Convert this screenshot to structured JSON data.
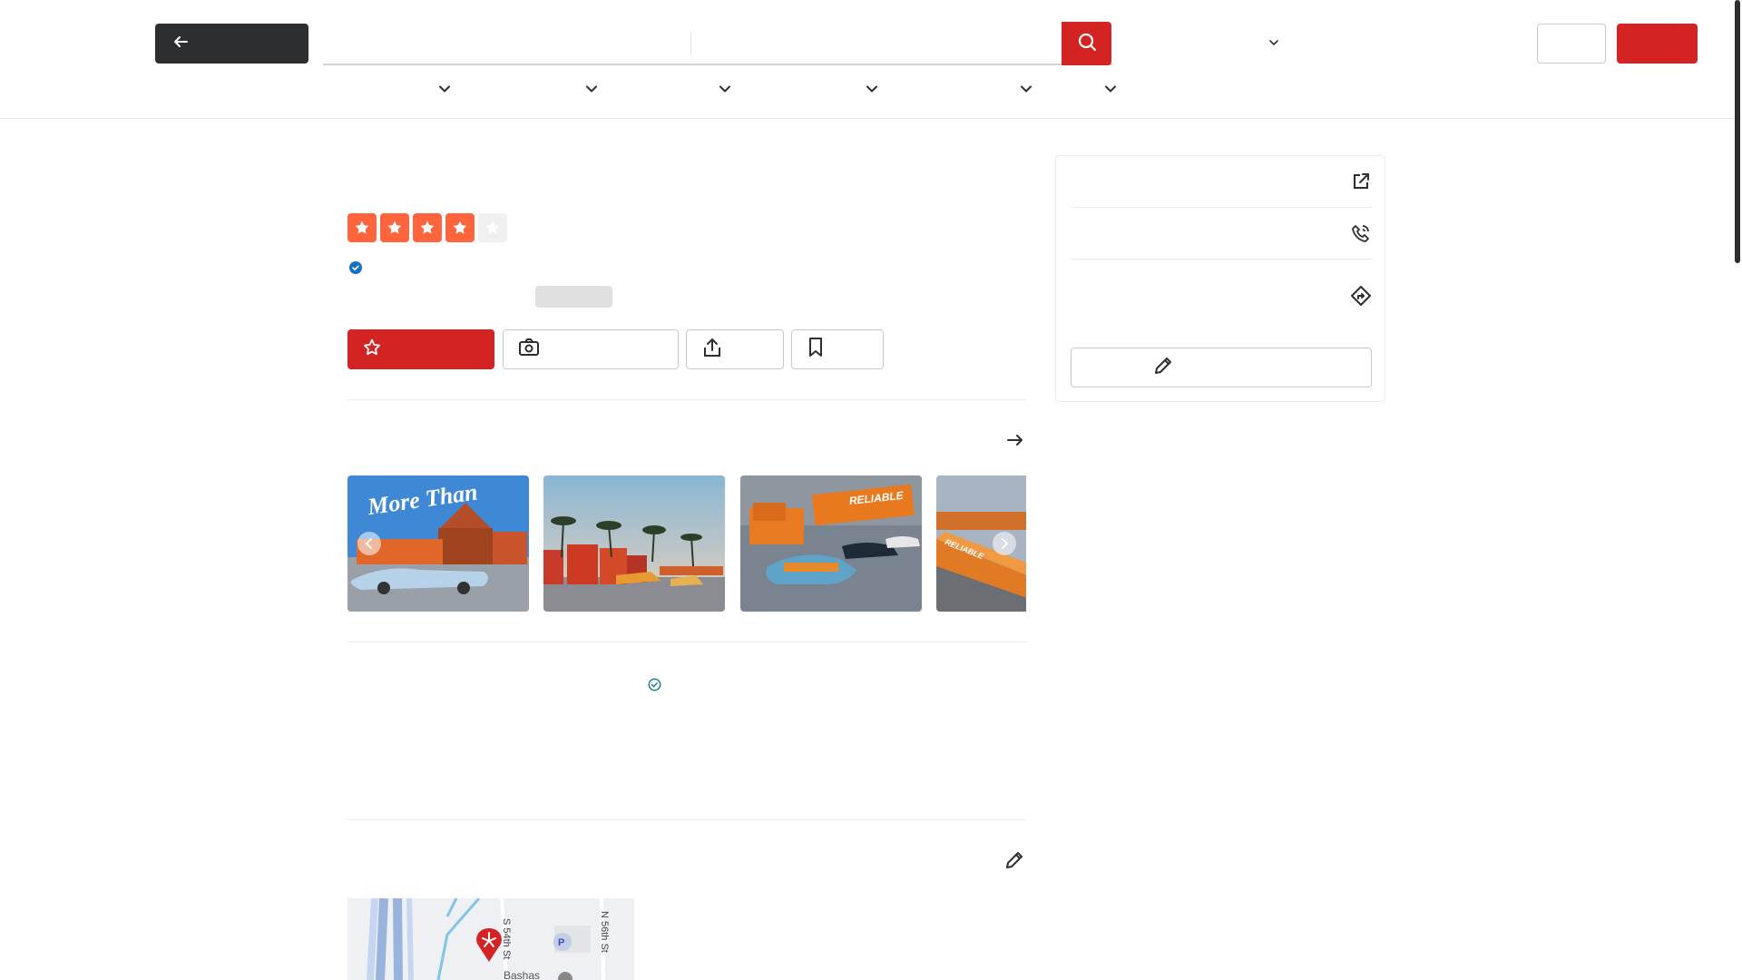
{
  "header": {
    "back_icon": "arrow-left-icon",
    "search_icon": "search-icon",
    "search_button_color": "#d32323",
    "signup_button_color": "#d32323",
    "category_chevron_count": 6
  },
  "business": {
    "rating": {
      "value": 4,
      "max": 5,
      "star_color": "#ff643d"
    },
    "verified_icon": "verified-badge-icon"
  },
  "actions": {
    "review_icon": "star-outline-icon",
    "photo_icon": "camera-icon",
    "share_icon": "share-icon",
    "save_icon": "bookmark-icon"
  },
  "photos": {
    "items": [
      {
        "caption": "More Than",
        "icon": "photo-thumbnail"
      },
      {
        "caption": "",
        "icon": "photo-thumbnail"
      },
      {
        "caption": "RELIABLE",
        "icon": "photo-thumbnail"
      },
      {
        "caption": "RELIABLE",
        "icon": "photo-thumbnail"
      }
    ],
    "see_all_icon": "arrow-right-icon"
  },
  "map": {
    "street_1": "S 54th St",
    "street_2": "N 56th St",
    "place": "Bashas",
    "parking": "P"
  },
  "sidebar": {
    "website_icon": "external-link-icon",
    "phone_icon": "phone-icon",
    "directions_icon": "directions-icon",
    "suggest_icon": "pencil-icon"
  },
  "colors": {
    "brand_red": "#d32323",
    "dark": "#2d2e2f",
    "border": "#c8c9ca",
    "verified_blue": "#1570c4"
  }
}
